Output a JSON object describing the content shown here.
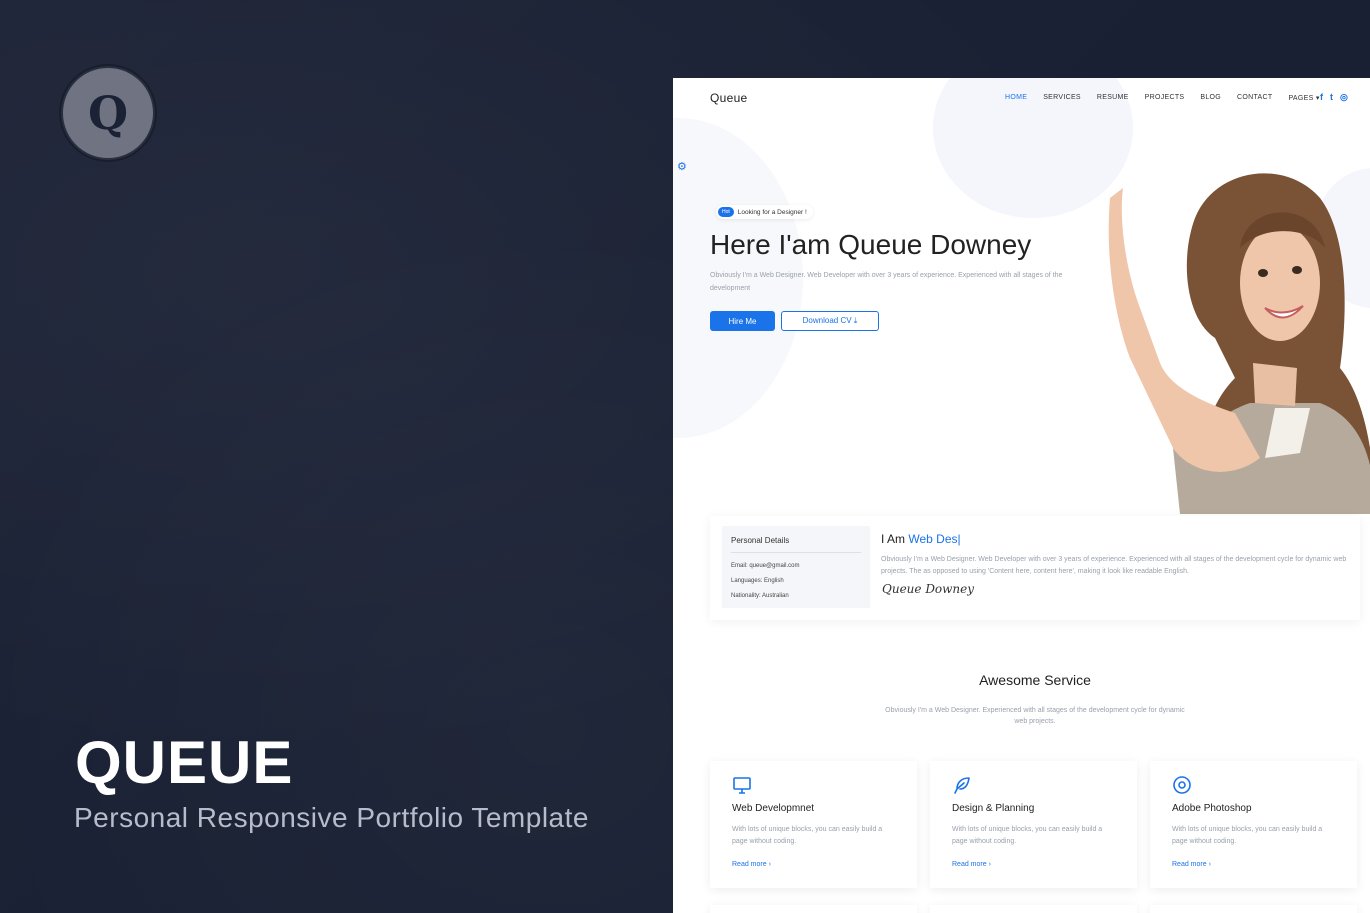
{
  "promo": {
    "logo_letter": "Q",
    "title": "QUEUE",
    "subtitle": "Personal Responsive Portfolio Template"
  },
  "site": {
    "logo": "Queue",
    "nav": [
      {
        "label": "HOME",
        "active": true
      },
      {
        "label": "SERVICES"
      },
      {
        "label": "RESUME"
      },
      {
        "label": "PROJECTS"
      },
      {
        "label": "BLOG"
      },
      {
        "label": "CONTACT"
      },
      {
        "label": "PAGES ▾"
      }
    ],
    "social": {
      "facebook": "f",
      "twitter": "t",
      "instagram": "◎"
    },
    "accent_color": "#1a73e8",
    "hero": {
      "badge": "Hot",
      "badge_text": "Looking for a Designer !",
      "title": "Here I'am Queue Downey",
      "description": "Obviously I'm a Web Designer. Web Developer with over 3 years of experience. Experienced with all stages of the development",
      "hire_label": "Hire Me",
      "cv_label": "Download CV ⤓"
    },
    "about": {
      "details_title": "Personal Details",
      "email": "Email: queue@gmail.com",
      "languages": "Languages: English",
      "nationality": "Nationality: Australian",
      "iam_prefix": "I Am",
      "iam_role": "Web Des|",
      "description": "Obviously I'm a Web Designer. Web Developer with over 3 years of experience. Experienced with all stages of the development cycle for dynamic web projects. The as opposed to using 'Content here, content here', making it look like readable English.",
      "signature": "Queue Downey"
    },
    "services": {
      "title": "Awesome Service",
      "description": "Obviously I'm a Web Designer. Experienced with all stages of the development cycle for dynamic web projects.",
      "cards": [
        {
          "icon": "monitor-icon",
          "title": "Web Developmnet",
          "desc": "With lots of unique blocks, you can easily build a page without coding.",
          "more": "Read more ›"
        },
        {
          "icon": "feather-icon",
          "title": "Design & Planning",
          "desc": "With lots of unique blocks, you can easily build a page without coding.",
          "more": "Read more ›"
        },
        {
          "icon": "target-icon",
          "title": "Adobe Photoshop",
          "desc": "With lots of unique blocks, you can easily build a page without coding.",
          "more": "Read more ›"
        }
      ]
    }
  }
}
